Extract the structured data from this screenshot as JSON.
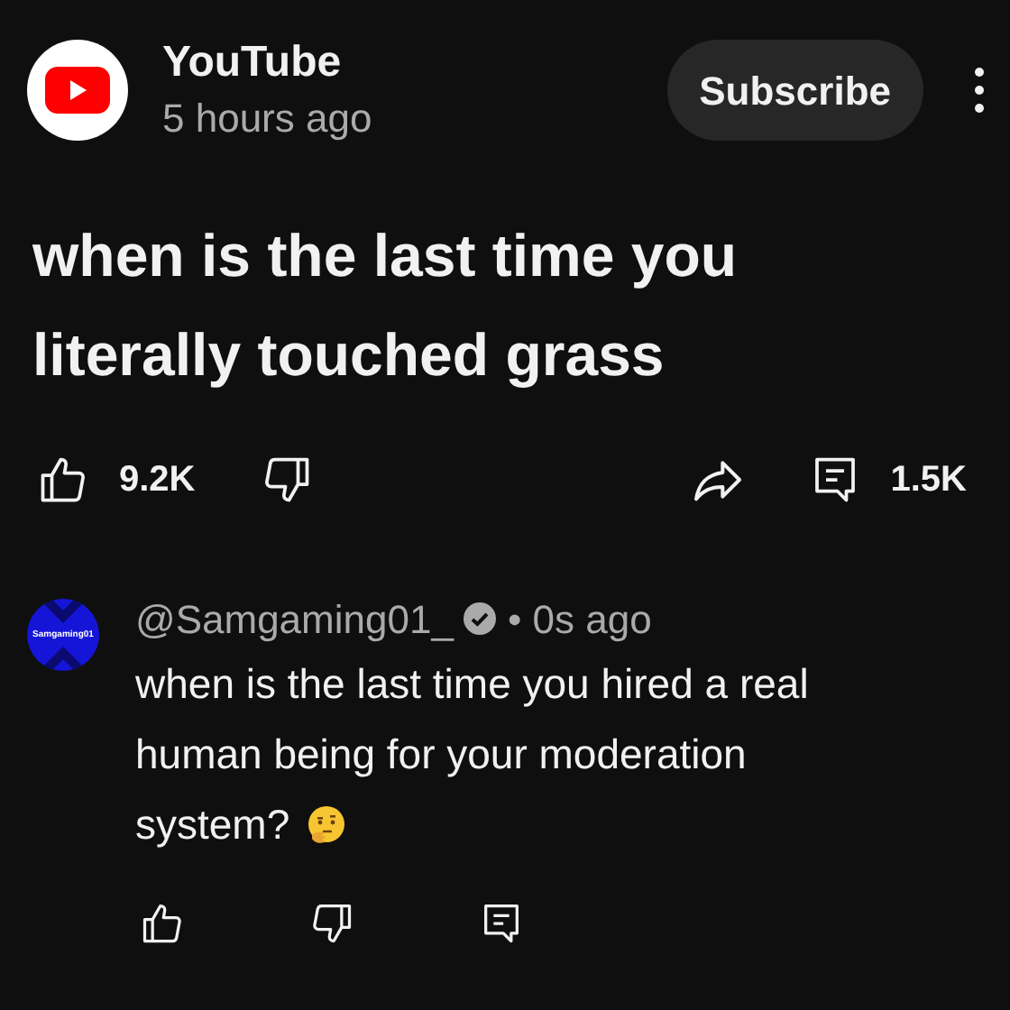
{
  "post": {
    "channel": "YouTube",
    "time": "5 hours ago",
    "subscribe": "Subscribe",
    "text": "when is the last time you literally touched grass",
    "likes": "9.2K",
    "comments": "1.5K"
  },
  "comment": {
    "avatar_text": "Samgaming01",
    "author": "@Samgaming01_",
    "verified": true,
    "time": "• 0s ago",
    "text": "when is the last time you hired a real human being for your moderation system?"
  }
}
